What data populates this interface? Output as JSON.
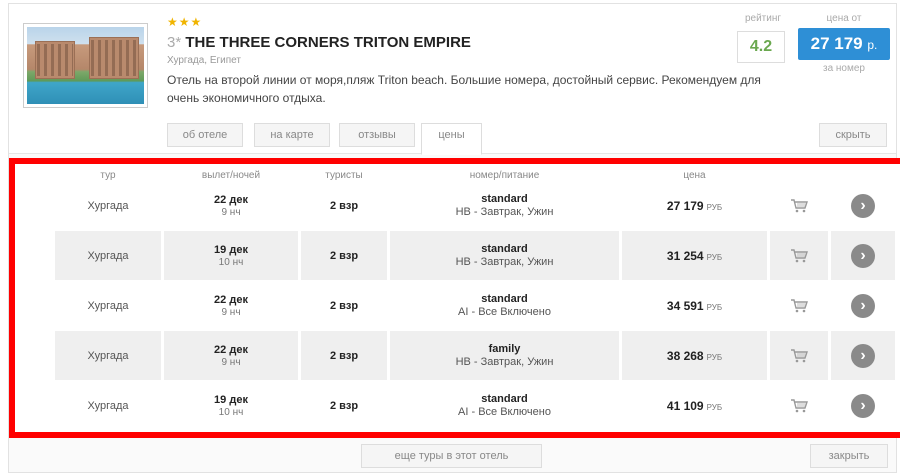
{
  "hotel": {
    "stars": "★★★",
    "class_label": "3*",
    "name": "THE THREE CORNERS TRITON EMPIRE",
    "location": "Хургада, Египет",
    "description": "Отель на второй линии от моря,пляж Triton beach. Большие номера, достойный сервис. Рекомендуем для очень экономичного отдыха.",
    "rating_label": "рейтинг",
    "rating": "4.2",
    "price_from_label": "цена от",
    "price_from": "27 179",
    "price_currency": "р.",
    "per_room_label": "за номер"
  },
  "tabs": [
    {
      "label": "об отеле"
    },
    {
      "label": "на карте"
    },
    {
      "label": "отзывы"
    },
    {
      "label": "цены"
    }
  ],
  "hide_label": "скрыть",
  "table": {
    "headers": {
      "tur": "тур",
      "departure": "вылет/ночей",
      "tourists": "туристы",
      "room": "номер/питание",
      "price": "цена"
    },
    "rows": [
      {
        "resort": "Хургада",
        "date": "22 дек",
        "nights": "9 нч",
        "tourists": "2 взр",
        "room": "standard",
        "meal": "HB - Завтрак, Ужин",
        "price": "27 179",
        "cur": "РУБ"
      },
      {
        "resort": "Хургада",
        "date": "19 дек",
        "nights": "10 нч",
        "tourists": "2 взр",
        "room": "standard",
        "meal": "HB - Завтрак, Ужин",
        "price": "31 254",
        "cur": "РУБ"
      },
      {
        "resort": "Хургада",
        "date": "22 дек",
        "nights": "9 нч",
        "tourists": "2 взр",
        "room": "standard",
        "meal": "AI - Все Включено",
        "price": "34 591",
        "cur": "РУБ"
      },
      {
        "resort": "Хургада",
        "date": "22 дек",
        "nights": "9 нч",
        "tourists": "2 взр",
        "room": "family",
        "meal": "HB - Завтрак, Ужин",
        "price": "38 268",
        "cur": "РУБ"
      },
      {
        "resort": "Хургада",
        "date": "19 дек",
        "nights": "10 нч",
        "tourists": "2 взр",
        "room": "standard",
        "meal": "AI - Все Включено",
        "price": "41 109",
        "cur": "РУБ"
      }
    ]
  },
  "more_label": "еще туры в этот отель",
  "close_label": "закрыть",
  "colors": {
    "accent": "#2e8fd6",
    "rating": "#6aa84f",
    "highlight": "#ff0000"
  }
}
